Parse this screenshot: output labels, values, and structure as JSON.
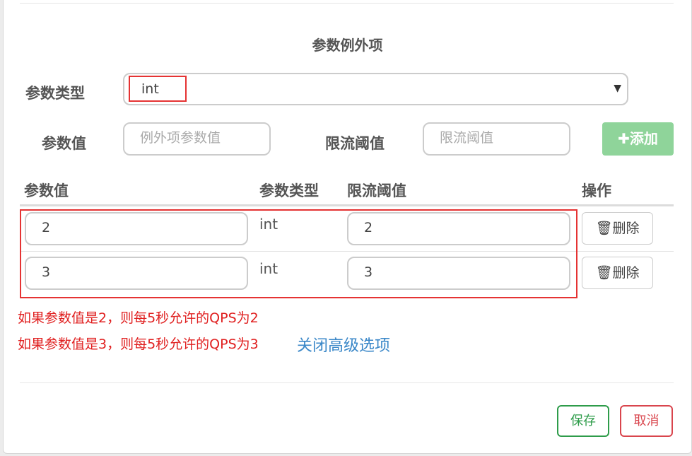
{
  "section_title": "参数例外项",
  "param_type": {
    "label": "参数类型",
    "selected": "int"
  },
  "new_item": {
    "value_label": "参数值",
    "value_placeholder": "例外项参数值",
    "threshold_label": "限流阈值",
    "threshold_placeholder": "限流阈值",
    "add_label": "添加",
    "add_icon": "plus-icon"
  },
  "table": {
    "headers": [
      "参数值",
      "参数类型",
      "限流阈值",
      "操作"
    ],
    "rows": [
      {
        "value": "2",
        "type": "int",
        "threshold": "2",
        "action": "删除"
      },
      {
        "value": "3",
        "type": "int",
        "threshold": "3",
        "action": "删除"
      }
    ],
    "delete_icon": "trash-icon"
  },
  "notes": [
    "如果参数值是2，则每5秒允许的QPS为2",
    "如果参数值是3，则每5秒允许的QPS为3"
  ],
  "advanced_link": "关闭高级选项",
  "footer": {
    "save": "保存",
    "cancel": "取消"
  },
  "colors": {
    "highlight": "#e53333",
    "add_button": "#8fd49a",
    "link": "#3a87c8",
    "save": "#2e9c4a",
    "cancel": "#d9454d",
    "note": "#e02020"
  }
}
